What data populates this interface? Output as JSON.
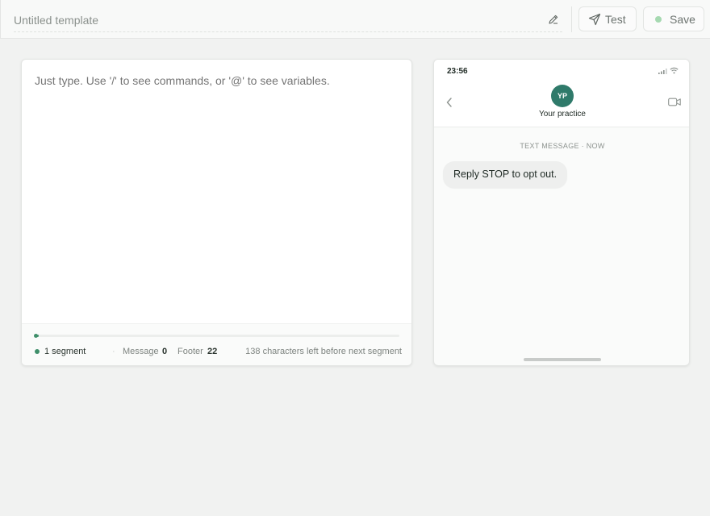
{
  "header": {
    "title": "Untitled template",
    "test_label": "Test",
    "save_label": "Save"
  },
  "editor": {
    "placeholder": "Just type. Use '/' to see commands, or '@' to see variables.",
    "segment_progress": 0.01,
    "stats": {
      "segments": "1 segment",
      "separator": "·",
      "message_label": "Message",
      "message_value": "0",
      "footer_label": "Footer",
      "footer_value": "22",
      "chars_left": "138 characters left before next segment"
    }
  },
  "preview": {
    "time": "23:56",
    "avatar_initials": "YP",
    "contact_name": "Your practice",
    "message_meta": "TEXT MESSAGE · NOW",
    "message_text": "Reply STOP to opt out."
  },
  "colors": {
    "accent": "#3f8f6a",
    "avatar": "#2f7a6a",
    "save_dot": "#a6d9b1"
  }
}
